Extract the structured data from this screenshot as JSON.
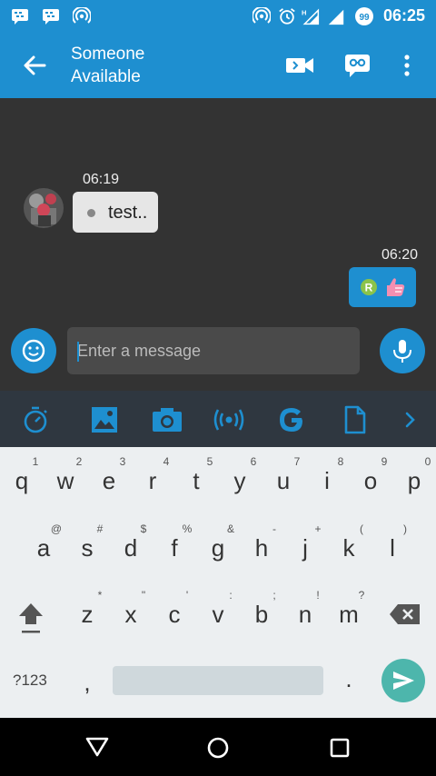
{
  "status_bar": {
    "time": "06:25"
  },
  "contact": {
    "name": "Someone",
    "status": "Available"
  },
  "messages": [
    {
      "direction": "incoming",
      "time": "06:19",
      "text": "test.."
    },
    {
      "direction": "outgoing",
      "time": "06:20",
      "content": "R badge + thumbs-up sticker"
    }
  ],
  "composer": {
    "placeholder": "Enter a message"
  },
  "toolbar_icons": [
    "timer-icon",
    "image-icon",
    "camera-icon",
    "broadcast-icon",
    "google-icon",
    "file-icon",
    "chevron-right-icon"
  ],
  "keyboard": {
    "row1": [
      "q",
      "w",
      "e",
      "r",
      "t",
      "y",
      "u",
      "i",
      "o",
      "p"
    ],
    "row1_hints": [
      "1",
      "2",
      "3",
      "4",
      "5",
      "6",
      "7",
      "8",
      "9",
      "0"
    ],
    "row2": [
      "a",
      "s",
      "d",
      "f",
      "g",
      "h",
      "j",
      "k",
      "l"
    ],
    "row2_hints": [
      "@",
      "#",
      "$",
      "%",
      "&",
      "-",
      "+",
      "(",
      ")"
    ],
    "row3": [
      "z",
      "x",
      "c",
      "v",
      "b",
      "n",
      "m"
    ],
    "row3_hints": [
      "*",
      "\"",
      "'",
      ":",
      ";",
      "!",
      "?"
    ],
    "symbols_key": "?123",
    "comma_key": ",",
    "period_key": "."
  },
  "colors": {
    "accent": "#1e8fd0",
    "chat_bg": "#333333",
    "toolbar_bg": "#2f3740",
    "keyboard_bg": "#eceff1",
    "send": "#4db6ac"
  }
}
